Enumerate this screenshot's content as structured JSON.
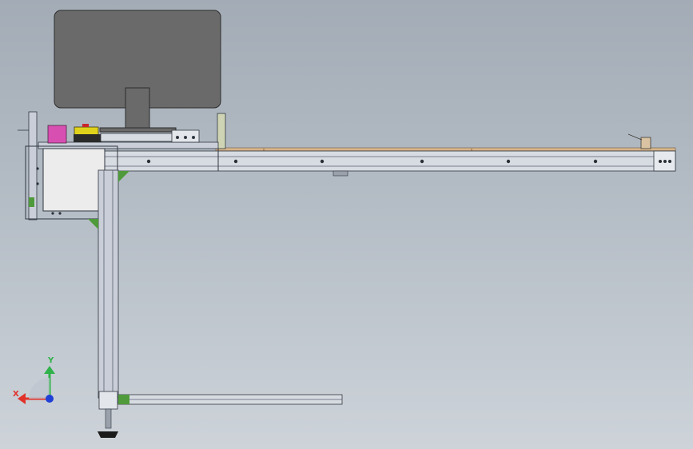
{
  "view": {
    "background_top": "#a3acb6",
    "background_bottom": "#cdd3d9"
  },
  "triad": {
    "x_label": "X",
    "y_label": "Y",
    "x_color": "#e1322a",
    "y_color": "#2fb24a",
    "z_color": "#1f3fd6"
  },
  "parts": {
    "monitor_color": "#6a6a6a",
    "frame_color": "#c9ced8",
    "beam_color": "#d7dbe2",
    "wood_strip_color": "#d7b58a",
    "cabinet_color": "#ececec",
    "pink_block_color": "#d84fb2",
    "yellow_block_color": "#e0d21a",
    "green_bracket_color": "#4f9a3a"
  }
}
